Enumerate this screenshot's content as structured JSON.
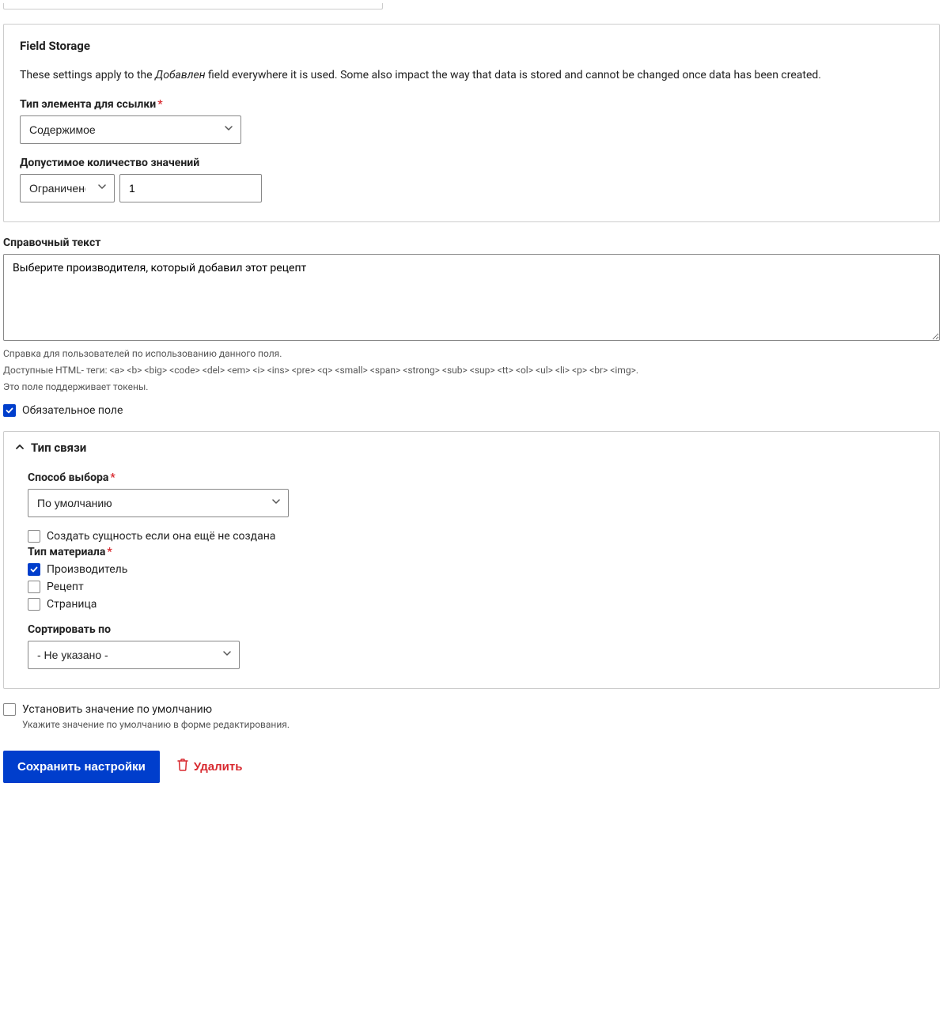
{
  "storage": {
    "title": "Field Storage",
    "desc_prefix": "These settings apply to the ",
    "desc_em": "Добавлен",
    "desc_suffix": " field everywhere it is used. Some also impact the way that data is stored and cannot be changed once data has been created.",
    "type_label": "Тип элемента для ссылки",
    "type_value": "Содержимое",
    "allowed_label": "Допустимое количество значений",
    "allowed_select": "Ограничено",
    "allowed_number": "1"
  },
  "help": {
    "label": "Справочный текст",
    "value": "Выберите производителя, который добавил этот рецепт",
    "desc1": "Справка для пользователей по использованию данного поля.",
    "desc2": "Доступные HTML- теги: <a> <b> <big> <code> <del> <em> <i> <ins> <pre> <q> <small> <span> <strong> <sub> <sup> <tt> <ol> <ul> <li> <p> <br> <img>.",
    "desc3": "Это поле поддерживает токены."
  },
  "required_label": "Обязательное поле",
  "reference": {
    "summary": "Тип связи",
    "method_label": "Способ выбора",
    "method_value": "По умолчанию",
    "create_label": "Создать сущность если она ещё не создана",
    "bundles_label": "Тип материала",
    "bundles": {
      "b0": "Производитель",
      "b1": "Рецепт",
      "b2": "Страница"
    },
    "sort_label": "Сортировать по",
    "sort_value": "- Не указано -"
  },
  "default": {
    "label": "Установить значение по умолчанию",
    "desc": "Укажите значение по умолчанию в форме редактирования."
  },
  "actions": {
    "save": "Сохранить настройки",
    "delete": "Удалить"
  }
}
